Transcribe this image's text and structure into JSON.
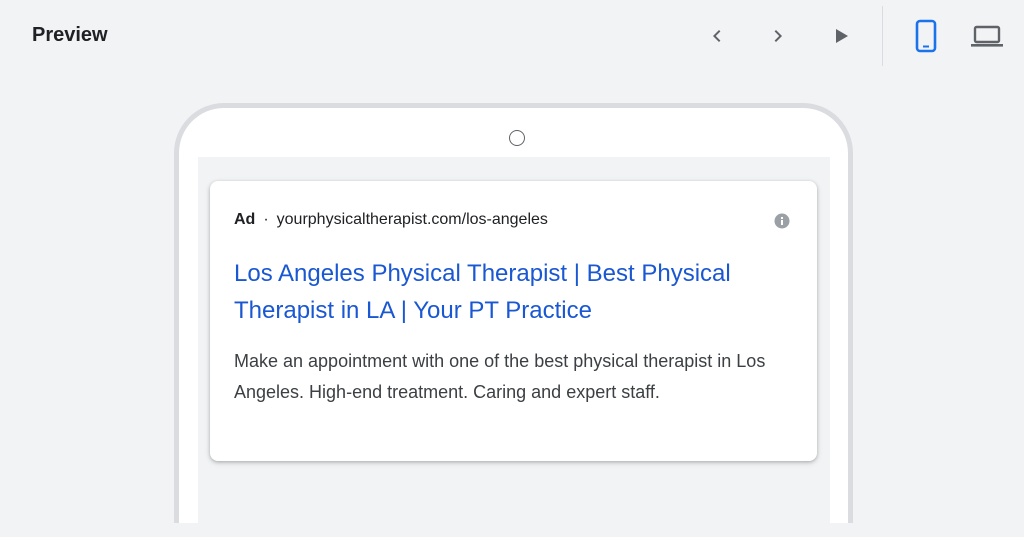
{
  "toolbar": {
    "title": "Preview",
    "icons": {
      "prev": "chevron-left-icon",
      "next": "chevron-right-icon",
      "play": "play-icon",
      "mobile": "smartphone-icon",
      "desktop": "laptop-icon"
    },
    "active_device": "mobile"
  },
  "ad": {
    "label": "Ad",
    "separator": "·",
    "url": "yourphysicaltherapist.com/los-angeles",
    "title": "Los Angeles Physical Therapist | Best Physical Therapist in LA | Your PT Practice",
    "description": "Make an appointment with one of the best physical therapist in Los Angeles. High-end treatment. Caring and expert staff."
  },
  "colors": {
    "accent": "#1a73e8",
    "ad_title": "#1a57d2",
    "icon_gray": "#5f6368",
    "background": "#f1f3f4",
    "device_frame": "#dadce0"
  }
}
